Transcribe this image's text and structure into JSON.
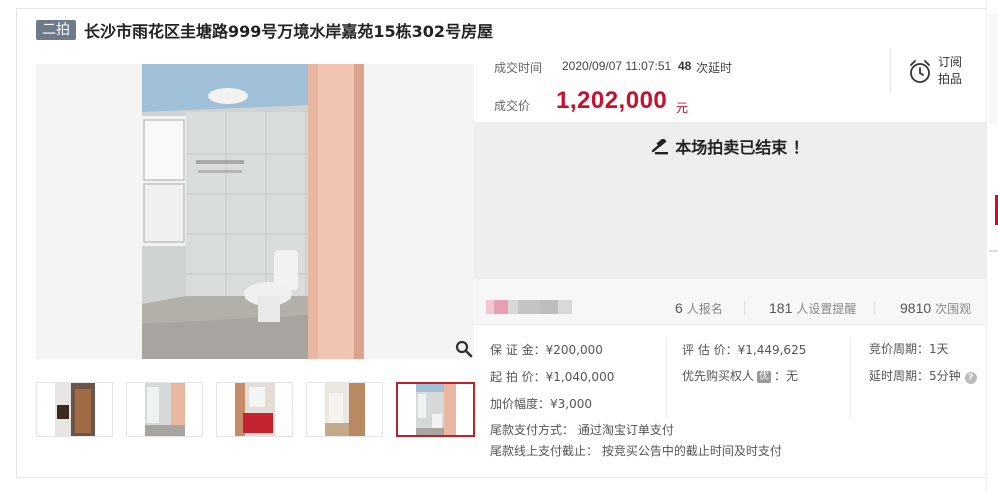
{
  "listing": {
    "round_badge": "二拍",
    "title": "长沙市雨花区圭塘路999号万境水岸嘉苑15栋302号房屋"
  },
  "gallery": {
    "thumbnail_count": 5,
    "active_index": 4
  },
  "deal": {
    "time_label": "成交时间",
    "time_value": "2020/09/07 11:07:51",
    "delay_count": "48",
    "delay_label": "次延时",
    "price_label": "成交价",
    "price_value": "1,202,000",
    "price_unit": "元",
    "price_color": "#c8102e"
  },
  "subscribe": {
    "label_line1": "订阅",
    "label_line2": "拍品",
    "icon": "alarm-clock-icon"
  },
  "status": {
    "ended_text": "本场拍卖已结束 ！",
    "icon": "gavel-icon"
  },
  "stats": {
    "signup_count": "6",
    "signup_label": "人报名",
    "reminder_count": "181",
    "reminder_label": "人设置提醒",
    "viewer_count": "9810",
    "viewer_label": "次围观"
  },
  "details": {
    "deposit": "保 证 金：¥200,000",
    "appraisal": "评 估 价：¥1,449,625",
    "bid_cycle": "竞价周期：1天",
    "starting_price": "起 拍 价：¥1,040,000",
    "priority_label": "优先购买权人",
    "priority_tag": "优",
    "priority_value": "：无",
    "delay_cycle": "延时周期：5分钟",
    "increment": "加价幅度：¥3,000",
    "payment_method": "尾款支付方式： 通过淘宝订单支付",
    "payment_deadline": "尾款线上支付截止： 按竞买公告中的截止时间及时支付"
  }
}
